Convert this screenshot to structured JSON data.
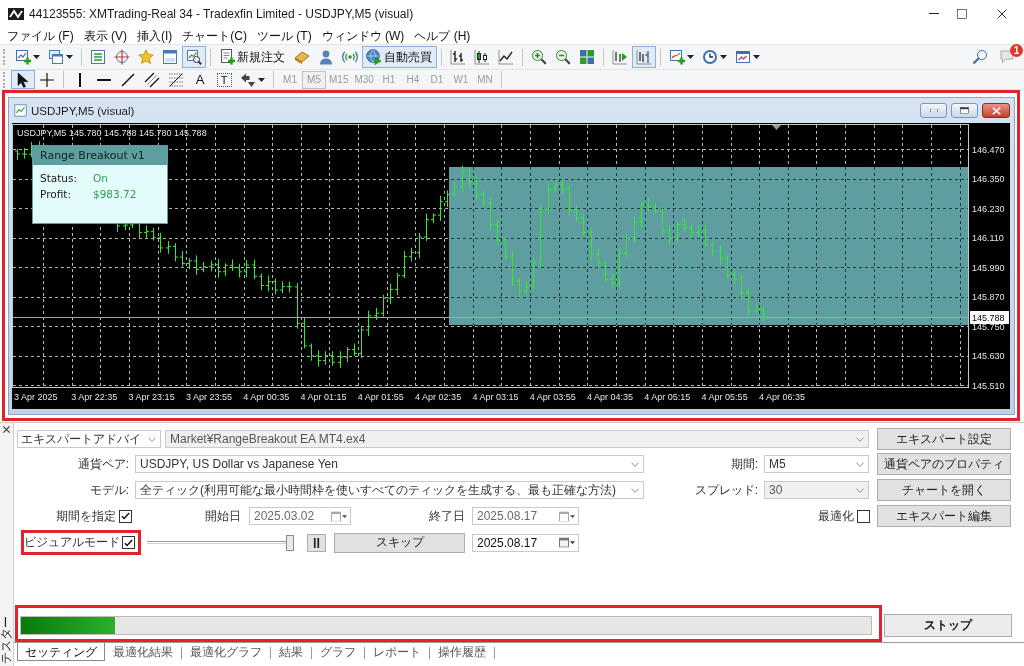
{
  "window": {
    "title": "44123555: XMTrading-Real 34 - Tradexfin Limited - USDJPY,M5 (visual)"
  },
  "menu": [
    "ファイル (F)",
    "表示 (V)",
    "挿入(I)",
    "チャート(C)",
    "ツール (T)",
    "ウィンドウ (W)",
    "ヘルプ (H)"
  ],
  "toolbar": {
    "groups": [
      {
        "buttons": [
          {
            "pressed": false,
            "dropdown": true
          },
          {
            "pressed": false,
            "dropdown": true
          }
        ]
      },
      {
        "buttons": [
          {
            "pressed": false,
            "dropdown": false
          },
          {
            "pressed": false,
            "dropdown": false
          },
          {
            "pressed": false,
            "dropdown": false
          },
          {
            "pressed": false,
            "dropdown": false
          },
          {
            "pressed": true,
            "dropdown": false
          }
        ]
      },
      {
        "buttons": [
          {
            "label": "新規注文",
            "pressed": false,
            "dropdown": false
          },
          {
            "pressed": false,
            "dropdown": false
          },
          {
            "pressed": false,
            "dropdown": false
          },
          {
            "pressed": false,
            "dropdown": false
          },
          {
            "label": "自動売買",
            "pressed": true,
            "dropdown": false
          }
        ]
      },
      {
        "buttons": [
          {
            "pressed": false,
            "dropdown": false
          },
          {
            "pressed": false,
            "dropdown": false
          },
          {
            "pressed": false,
            "dropdown": false
          }
        ]
      },
      {
        "buttons": [
          {
            "pressed": false,
            "dropdown": false
          },
          {
            "pressed": false,
            "dropdown": false
          },
          {
            "pressed": false,
            "dropdown": false
          }
        ]
      },
      {
        "buttons": [
          {
            "pressed": false,
            "dropdown": false
          },
          {
            "pressed": true,
            "dropdown": false
          }
        ]
      },
      {
        "buttons": [
          {
            "pressed": false,
            "dropdown": true
          },
          {
            "pressed": false,
            "dropdown": true
          },
          {
            "pressed": false,
            "dropdown": true
          }
        ]
      }
    ],
    "notifications": {
      "count": "1"
    }
  },
  "drawing_toolbar": {
    "groups": [
      {
        "tools": [
          {
            "pressed": true,
            "dropdown": false
          },
          {
            "pressed": false,
            "dropdown": false
          }
        ]
      },
      {
        "tools": [
          {
            "pressed": false,
            "dropdown": false
          },
          {
            "pressed": false,
            "dropdown": false
          },
          {
            "pressed": false,
            "dropdown": false
          },
          {
            "pressed": false,
            "dropdown": false
          },
          {
            "pressed": false,
            "dropdown": false
          },
          {
            "label": "A",
            "pressed": false,
            "dropdown": false
          },
          {
            "label": "T",
            "pressed": false,
            "dropdown": false
          },
          {
            "pressed": false,
            "dropdown": true
          }
        ]
      }
    ],
    "timeframes": [
      {
        "label": "M1",
        "selected": false,
        "disabled": true
      },
      {
        "label": "M5",
        "selected": true,
        "disabled": true
      },
      {
        "label": "M15",
        "selected": false,
        "disabled": true
      },
      {
        "label": "M30",
        "selected": false,
        "disabled": true
      },
      {
        "label": "H1",
        "selected": false,
        "disabled": true
      },
      {
        "label": "H4",
        "selected": false,
        "disabled": true
      },
      {
        "label": "D1",
        "selected": false,
        "disabled": true
      },
      {
        "label": "W1",
        "selected": false,
        "disabled": true
      },
      {
        "label": "MN",
        "selected": false,
        "disabled": true
      }
    ]
  },
  "chart_window": {
    "title": "USDJPY,M5 (visual)",
    "highlighted": true,
    "symbol": "USDJPY,M5",
    "ohlc": "145.780 145.788 145.780 145.788",
    "info_panel": {
      "title": "Range Breakout v1",
      "rows": [
        {
          "label": "Status:",
          "value": "On"
        },
        {
          "label": "Profit:",
          "value": "$983.72"
        }
      ]
    },
    "price_axis": [
      "146.470",
      "146.350",
      "146.230",
      "146.110",
      "145.990",
      "145.870",
      "145.750",
      "145.630",
      "145.510"
    ],
    "current_price": "145.788",
    "time_axis": [
      "3 Apr 2025",
      "3 Apr 22:35",
      "3 Apr 23:15",
      "3 Apr 23:55",
      "4 Apr 00:35",
      "4 Apr 01:15",
      "4 Apr 01:55",
      "4 Apr 02:35",
      "4 Apr 03:15",
      "4 Apr 03:55",
      "4 Apr 04:35",
      "4 Apr 05:15",
      "4 Apr 05:55",
      "4 Apr 06:35"
    ]
  },
  "tester": {
    "side_label": "テスター",
    "program_type": {
      "value": "エキスパートアドバイ",
      "disabled": false
    },
    "expert": {
      "value": "Market¥RangeBreakout EA MT4.ex4",
      "disabled": true
    },
    "symbol": {
      "label": "通貨ペア:",
      "value": "USDJPY, US Dollar vs Japanese Yen",
      "disabled": false
    },
    "period": {
      "label": "期間:",
      "value": "M5",
      "disabled": false
    },
    "model": {
      "label": "モデル:",
      "value": "全ティック(利用可能な最小時間枠を使いすべてのティックを生成する、最も正確な方法)",
      "disabled": false
    },
    "spread": {
      "label": "スプレッド:",
      "value": "30",
      "disabled": true
    },
    "use_date": {
      "label": "期間を指定",
      "checked": true
    },
    "from_date": {
      "label": "開始日",
      "value": "2025.03.02",
      "disabled": true
    },
    "to_date": {
      "label": "終了日",
      "value": "2025.08.17",
      "disabled": true
    },
    "optimization": {
      "label": "最適化",
      "checked": false
    },
    "visual_mode": {
      "label": "ビジュアルモード",
      "checked": true,
      "highlighted": true
    },
    "speed": {
      "level": 1
    },
    "skip_button": "スキップ",
    "skip_to": {
      "value": "2025.08.17",
      "disabled": false
    },
    "side_buttons": [
      "エキスパート設定",
      "通貨ペアのプロパティ",
      "チャートを開く",
      "エキスパート編集"
    ],
    "progress": {
      "level": 0.11,
      "highlighted": true
    },
    "stop_button": "ストップ",
    "tabs": [
      {
        "label": "セッティング",
        "selected": true
      },
      {
        "label": "最適化結果",
        "selected": false
      },
      {
        "label": "最適化グラフ",
        "selected": false
      },
      {
        "label": "結果",
        "selected": false
      },
      {
        "label": "グラフ",
        "selected": false
      },
      {
        "label": "レポート",
        "selected": false
      },
      {
        "label": "操作履歴",
        "selected": false
      }
    ]
  }
}
